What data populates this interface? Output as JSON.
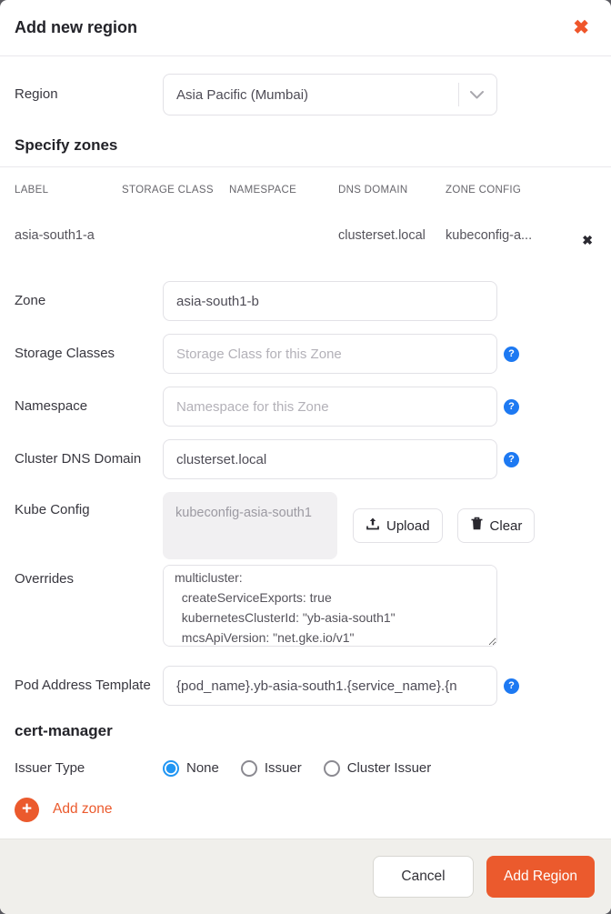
{
  "modal": {
    "title": "Add new region"
  },
  "icons": {
    "close": "✖",
    "row_remove": "✖",
    "help": "?",
    "plus": "+"
  },
  "region": {
    "label": "Region",
    "value": "Asia Pacific (Mumbai)"
  },
  "zones_section": {
    "heading": "Specify zones",
    "table": {
      "headers": [
        "LABEL",
        "STORAGE CLASS",
        "NAMESPACE",
        "DNS DOMAIN",
        "ZONE CONFIG"
      ],
      "rows": [
        {
          "label": "asia-south1-a",
          "storage_class": "",
          "namespace": "",
          "dns_domain": "clusterset.local",
          "zone_config": "kubeconfig-a..."
        }
      ]
    }
  },
  "zone_form": {
    "zone": {
      "label": "Zone",
      "value": "asia-south1-b"
    },
    "storage_classes": {
      "label": "Storage Classes",
      "placeholder": "Storage Class for this Zone"
    },
    "namespace": {
      "label": "Namespace",
      "placeholder": "Namespace for this Zone"
    },
    "cluster_dns_domain": {
      "label": "Cluster DNS Domain",
      "value": "clusterset.local"
    },
    "kube_config": {
      "label": "Kube Config",
      "value": "kubeconfig-asia-south1",
      "upload_label": "Upload",
      "clear_label": "Clear"
    },
    "overrides": {
      "label": "Overrides",
      "value": "multicluster:\n  createServiceExports: true\n  kubernetesClusterId: \"yb-asia-south1\"\n  mcsApiVersion: \"net.gke.io/v1\""
    },
    "pod_address_template": {
      "label": "Pod Address Template",
      "value": "{pod_name}.yb-asia-south1.{service_name}.{n"
    }
  },
  "cert_manager": {
    "heading": "cert-manager",
    "issuer_type": {
      "label": "Issuer Type",
      "options": [
        "None",
        "Issuer",
        "Cluster Issuer"
      ],
      "selected": "None"
    }
  },
  "add_zone_label": "Add zone",
  "footer": {
    "cancel_label": "Cancel",
    "submit_label": "Add Region"
  },
  "colors": {
    "accent_orange": "#EB5A2D",
    "close_orange": "#EF562B",
    "help_blue": "#1D79F2",
    "radio_blue": "#2196F3",
    "footer_bg": "#F0EFEB"
  }
}
